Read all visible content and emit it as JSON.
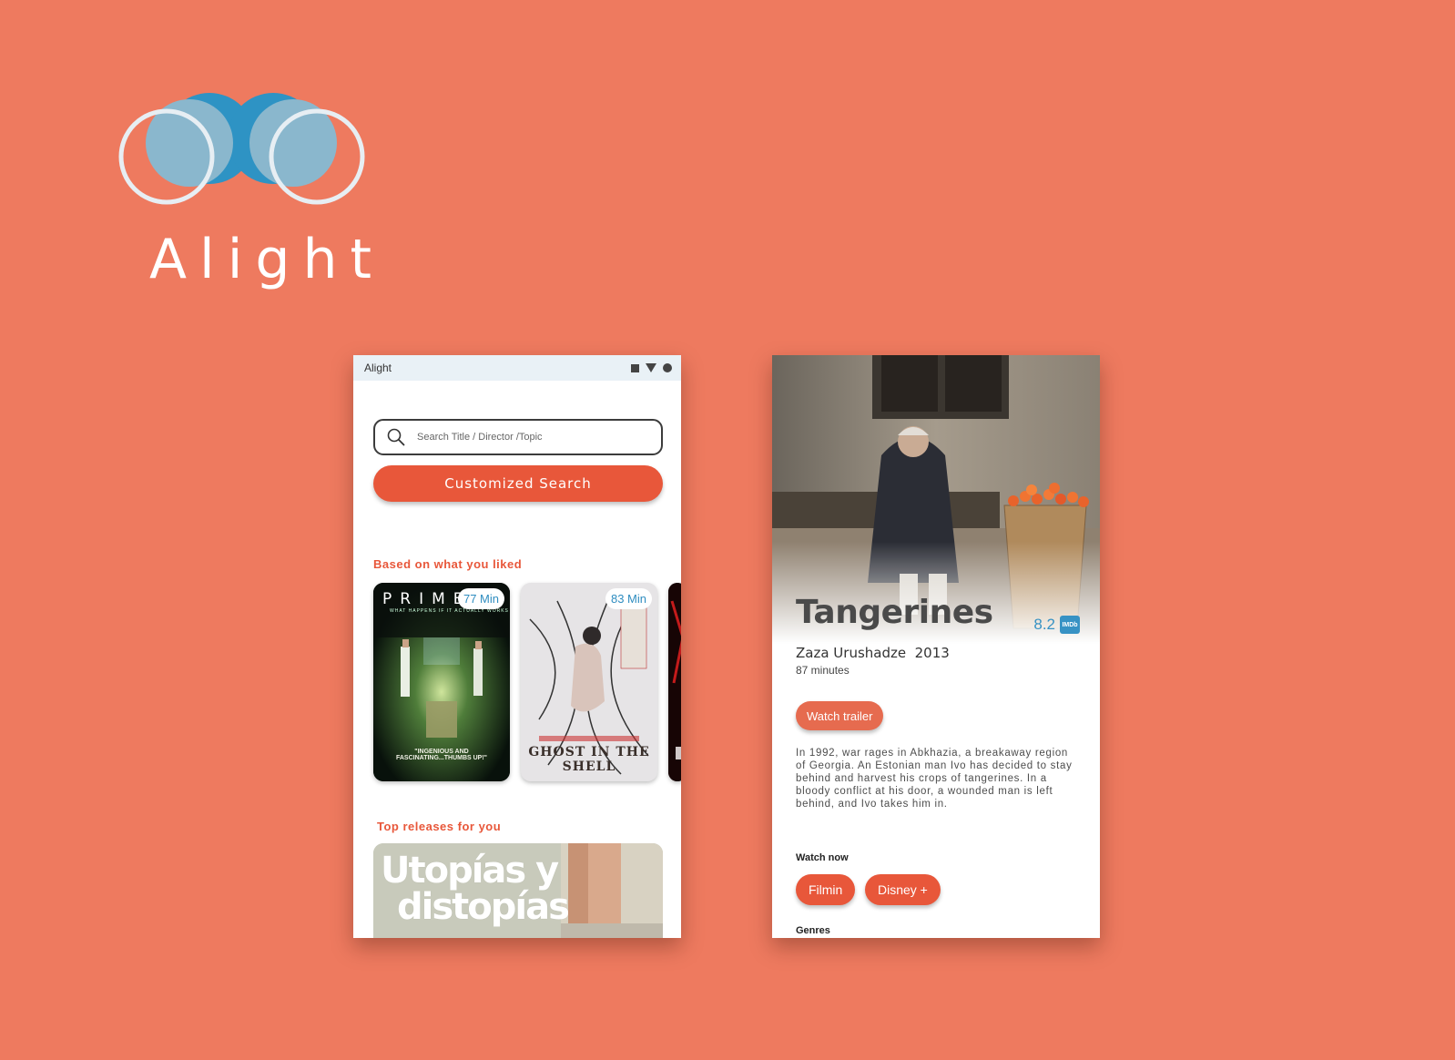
{
  "brand": {
    "name": "Alight"
  },
  "home": {
    "statusbar": {
      "title": "Alight",
      "icons": [
        "square-icon",
        "wifi-triangle-icon",
        "battery-dot-icon"
      ]
    },
    "search": {
      "placeholder": "Search Title / Director /Topic"
    },
    "customized_search_label": "Customized Search",
    "liked_section": {
      "title": "Based on what you liked",
      "items": [
        {
          "poster_title": "PRIMER",
          "tagline": "WHAT HAPPENS IF IT ACTUALLY WORKS",
          "quote": "\"INGENIOUS AND FASCINATING...THUMBS UP!\"",
          "duration": "77 Min"
        },
        {
          "poster_title": "GHOST IN THE SHELL",
          "duration": "83 Min"
        }
      ]
    },
    "top_section": {
      "title": "Top releases for you",
      "items": [
        {
          "headline_line1": "Utopías y",
          "headline_line2": "distopías"
        }
      ]
    }
  },
  "detail": {
    "title": "Tangerines",
    "rating": "8.2",
    "rating_source": "IMDb",
    "director": "Zaza Urushadze",
    "year": "2013",
    "runtime": "87 minutes",
    "trailer_label": "Watch trailer",
    "synopsis": "In 1992, war rages in Abkhazia, a breakaway region of Georgia. An Estonian man Ivo has decided to stay behind and harvest his crops of tangerines. In a bloody conflict at his door, a wounded man is left behind, and Ivo takes him in.",
    "watch_now_label": "Watch now",
    "providers": [
      "Filmin",
      "Disney +"
    ],
    "genres_label": "Genres"
  },
  "colors": {
    "background": "#ee7a5f",
    "accent": "#e8573a",
    "blue": "#2f8dc0"
  }
}
